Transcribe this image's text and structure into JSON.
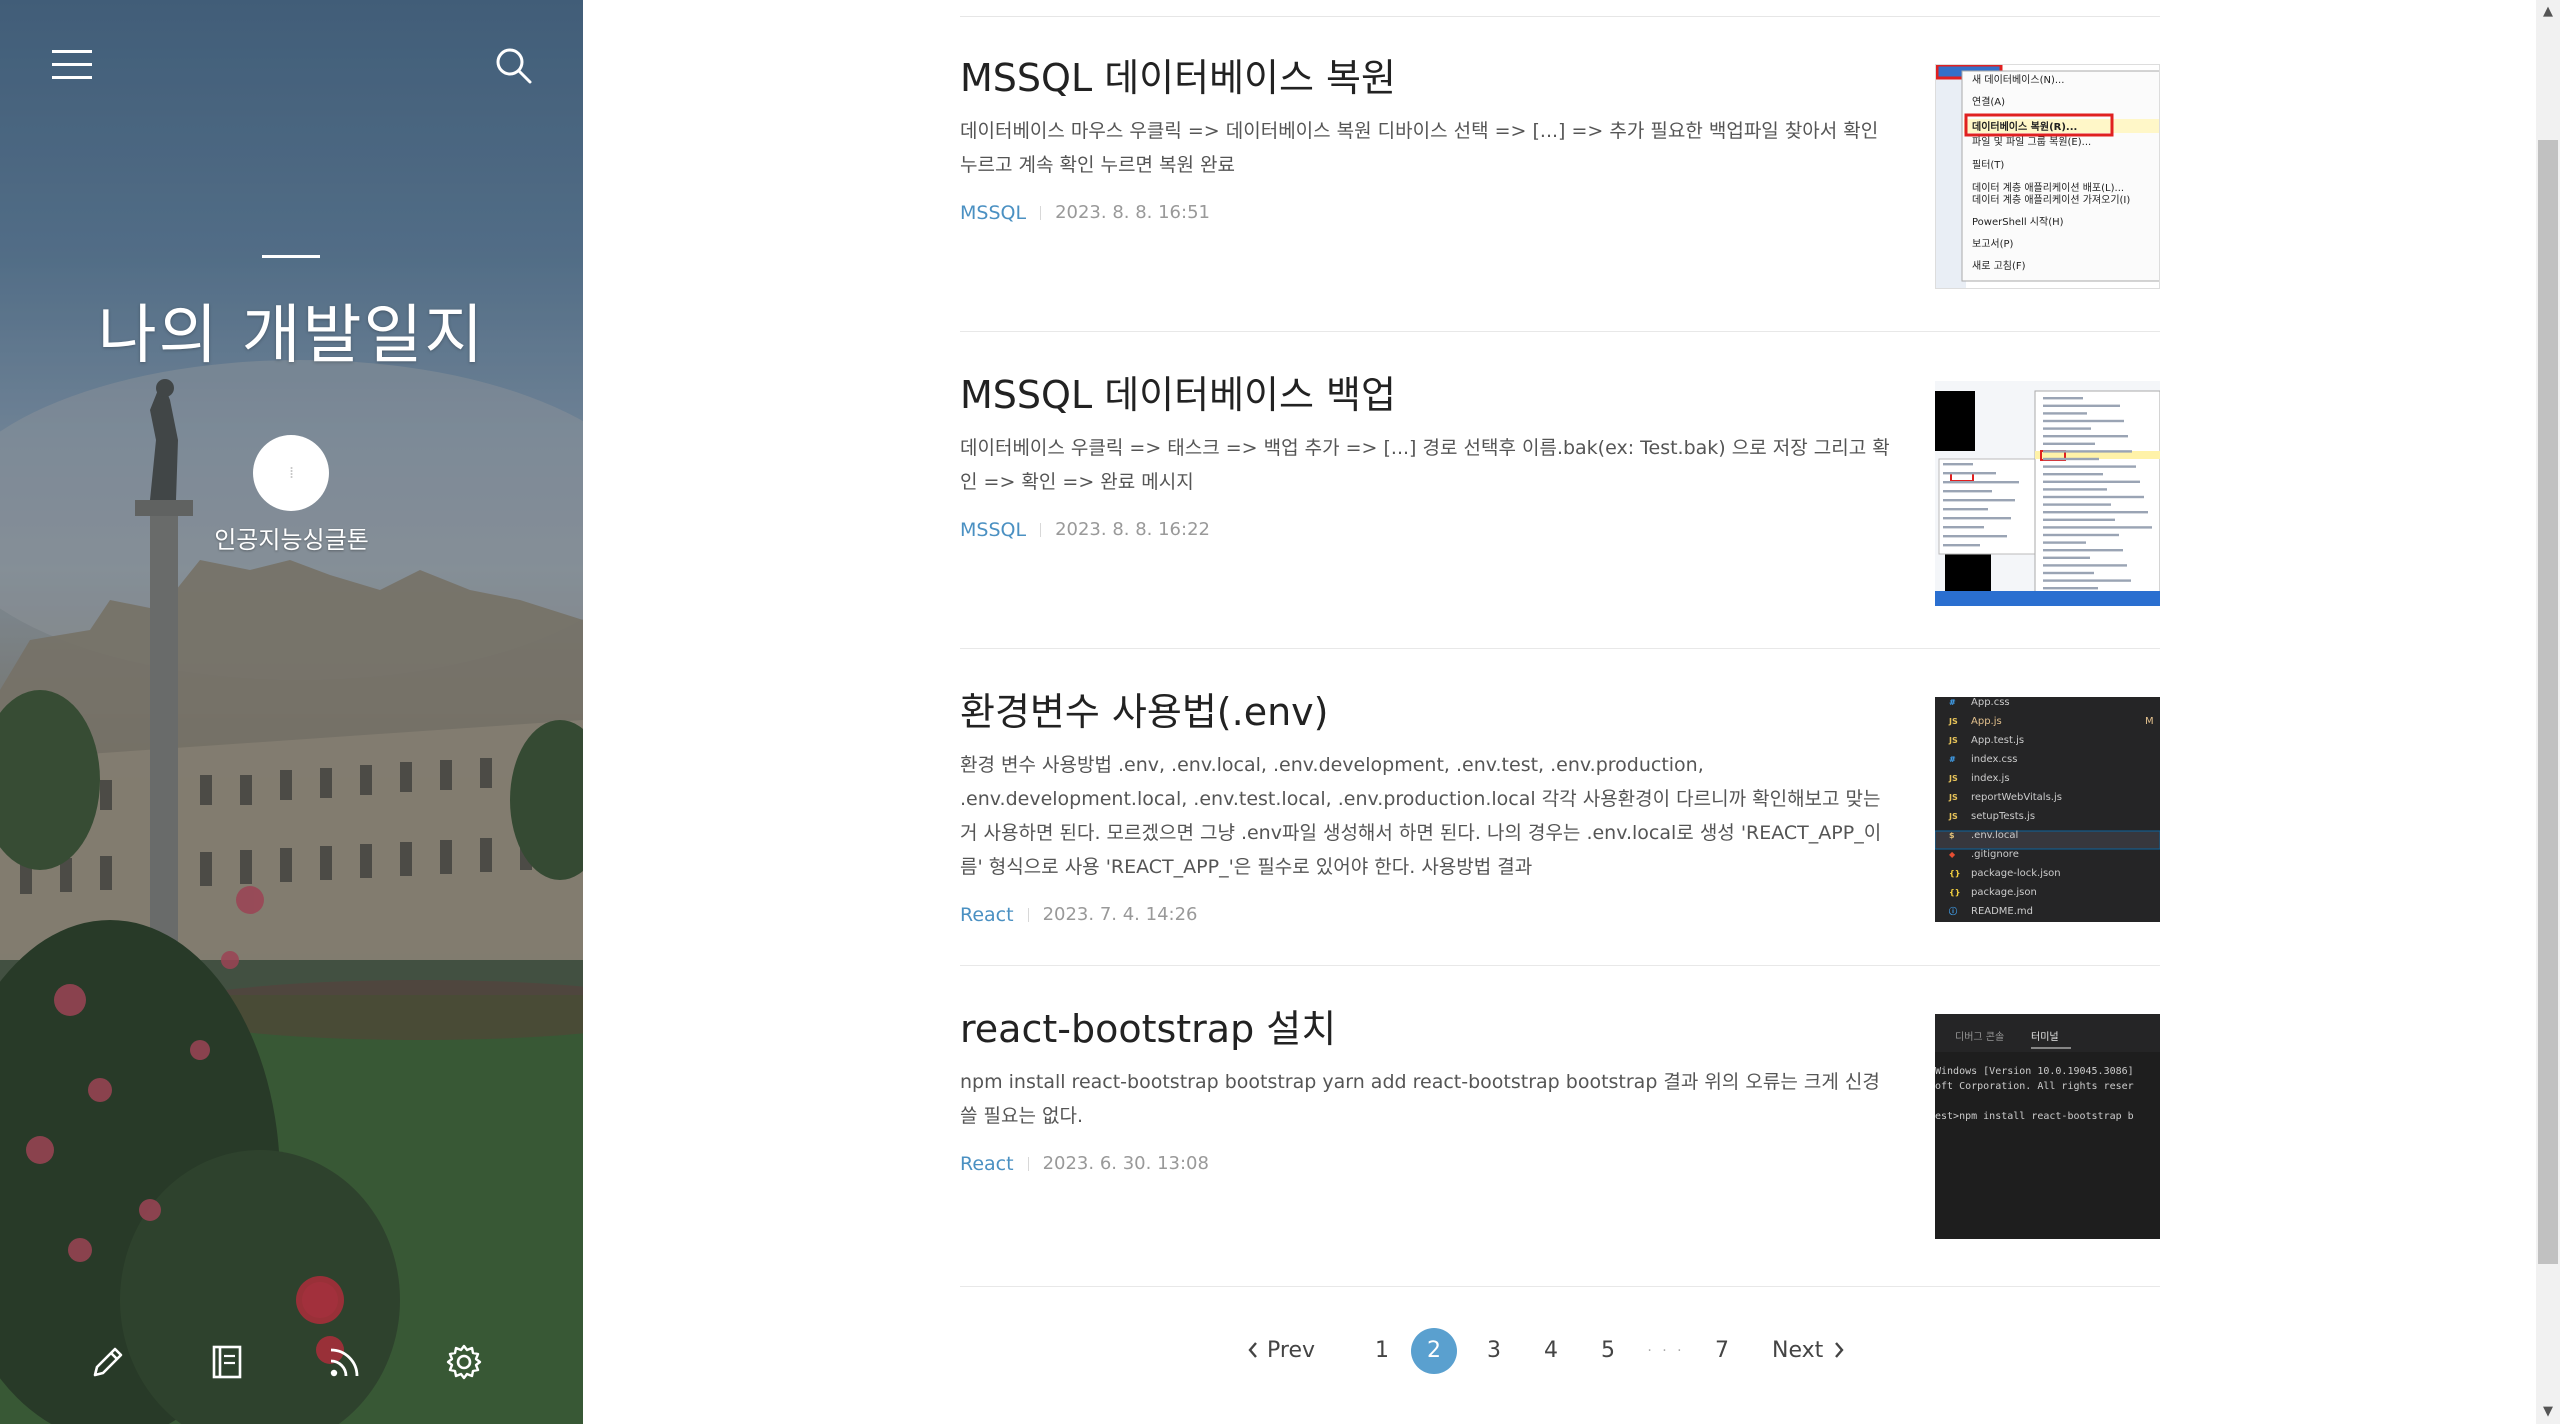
{
  "blog": {
    "title": "나의 개발일지",
    "profile_name": "인공지능싱글톤"
  },
  "posts": [
    {
      "title": "MSSQL 데이터베이스 복원",
      "excerpt": "데이터베이스 마우스 우클릭 => 데이터베이스 복원 디바이스 선택 => [...] => 추가 필요한 백업파일 찾아서 확인 누르고 계속 확인 누르면 복원 완료",
      "category": "MSSQL",
      "date": "2023. 8. 8. 16:51",
      "thumb": {
        "menu_items": [
          "새 데이터베이스(N)...",
          "연결(A)",
          "데이터베이스 복원(R)...",
          "파일 및 파일 그룹 복원(E)...",
          "필터(T)",
          "데이터 계층 애플리케이션 배포(L)...",
          "데이터 계층 애플리케이션 가져오기(I)",
          "PowerShell 시작(H)",
          "보고서(P)",
          "새로 고침(F)"
        ],
        "highlighted_index": 2
      }
    },
    {
      "title": "MSSQL 데이터베이스 백업",
      "excerpt": "데이터베이스 우클릭 => 태스크 => 백업 추가 => [...] 경로 선택후 이름.bak(ex: Test.bak) 으로 저장 그리고 확인 => 확인 => 완료 메시지",
      "category": "MSSQL",
      "date": "2023. 8. 8. 16:22"
    },
    {
      "title": "환경변수 사용법(.env)",
      "excerpt": "환경 변수 사용방법 .env, .env.local, .env.development, .env.test, .env.production, .env.development.local, .env.test.local, .env.production.local 각각 사용환경이 다르니까 확인해보고 맞는거 사용하면 된다. 모르겠으면 그냥 .env파일 생성해서 하면 된다. 나의 경우는 .env.local로 생성 'REACT_APP_이름' 형식으로 사용 'REACT_APP_'은 필수로 있어야 한다. 사용방법 결과",
      "category": "React",
      "date": "2023. 7. 4. 14:26",
      "thumb": {
        "files": [
          "App.css",
          "App.js",
          "App.test.js",
          "index.css",
          "index.js",
          "reportWebVitals.js",
          "setupTests.js",
          ".env.local",
          ".gitignore",
          "package-lock.json",
          "package.json",
          "README.md"
        ],
        "modified_marker": "M",
        "selected_index": 7
      }
    },
    {
      "title": "react-bootstrap 설치",
      "excerpt": "npm install react-bootstrap bootstrap yarn add react-bootstrap bootstrap 결과 위의 오류는 크게 신경 쓸 필요는 없다.",
      "category": "React",
      "date": "2023. 6. 30. 13:08",
      "thumb": {
        "tabs": [
          "디버그 콘솔",
          "터미널"
        ],
        "lines": [
          "Windows [Version 10.0.19045.3086]",
          "oft Corporation. All rights reser",
          "",
          "est>npm install react-bootstrap b"
        ]
      }
    }
  ],
  "pagination": {
    "prev": "Prev",
    "next": "Next",
    "pages": [
      "1",
      "2",
      "3",
      "4",
      "5",
      "7"
    ],
    "ellipsis": "· · ·",
    "current": "2"
  },
  "colors": {
    "accent": "#5aa0cf",
    "category": "#4a90c2"
  }
}
